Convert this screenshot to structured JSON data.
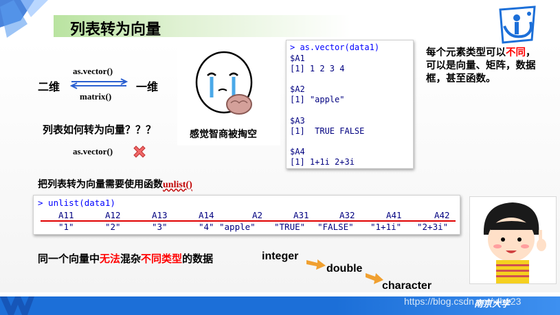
{
  "slide": {
    "title": "列表转为向量",
    "labels": {
      "one_dim": "二维",
      "two_dim": "一维",
      "as_vector_fn": "as.vector()",
      "matrix_fn": "matrix()"
    },
    "question": "列表如何转为向量？？？",
    "as_vector_wrong": "as.vector()",
    "meme_caption": "感觉智商被掏空"
  },
  "console_top": {
    "command": "> as.vector(data1)",
    "lines": [
      "$A1",
      "[1] 1 2 3 4",
      "",
      "$A2",
      "[1] \"apple\"",
      "",
      "$A3",
      "[1]  TRUE FALSE",
      "",
      "$A4",
      "[1] 1+1i 2+3i"
    ]
  },
  "description": {
    "part1": "每个元素类型可以",
    "red1": "不同",
    "part2": "，可以是",
    "bold1": "向量、矩阵，数据框",
    "part3": "，甚至函数。"
  },
  "unlist_section": {
    "text": "把列表转为向量需要使用函数",
    "fn": "unlist()"
  },
  "console_bottom": {
    "command": "> unlist(data1)",
    "names": [
      "A11",
      "A12",
      "A13",
      "A14",
      "A2",
      "A31",
      "A32",
      "A41",
      "A42"
    ],
    "values": [
      "\"1\"",
      "\"2\"",
      "\"3\"",
      "\"4\"",
      "\"apple\"",
      "\"TRUE\"",
      "\"FALSE\"",
      "\"1+1i\"",
      "\"2+3i\""
    ]
  },
  "bottom": {
    "prefix": "同一个向量中",
    "red1": "无法",
    "mid": "混杂",
    "red2": "不同类型",
    "suffix": "的数据",
    "type1": "integer",
    "type2": "double",
    "type3": "character"
  },
  "footer": {
    "url": "https://blog.csdn.net/xlh123",
    "university": "南京大学"
  },
  "colors": {
    "accent_blue": "#1c6fd8",
    "accent_red": "#ff0000",
    "console_text": "#000080",
    "arrow_orange": "#f0a030"
  }
}
